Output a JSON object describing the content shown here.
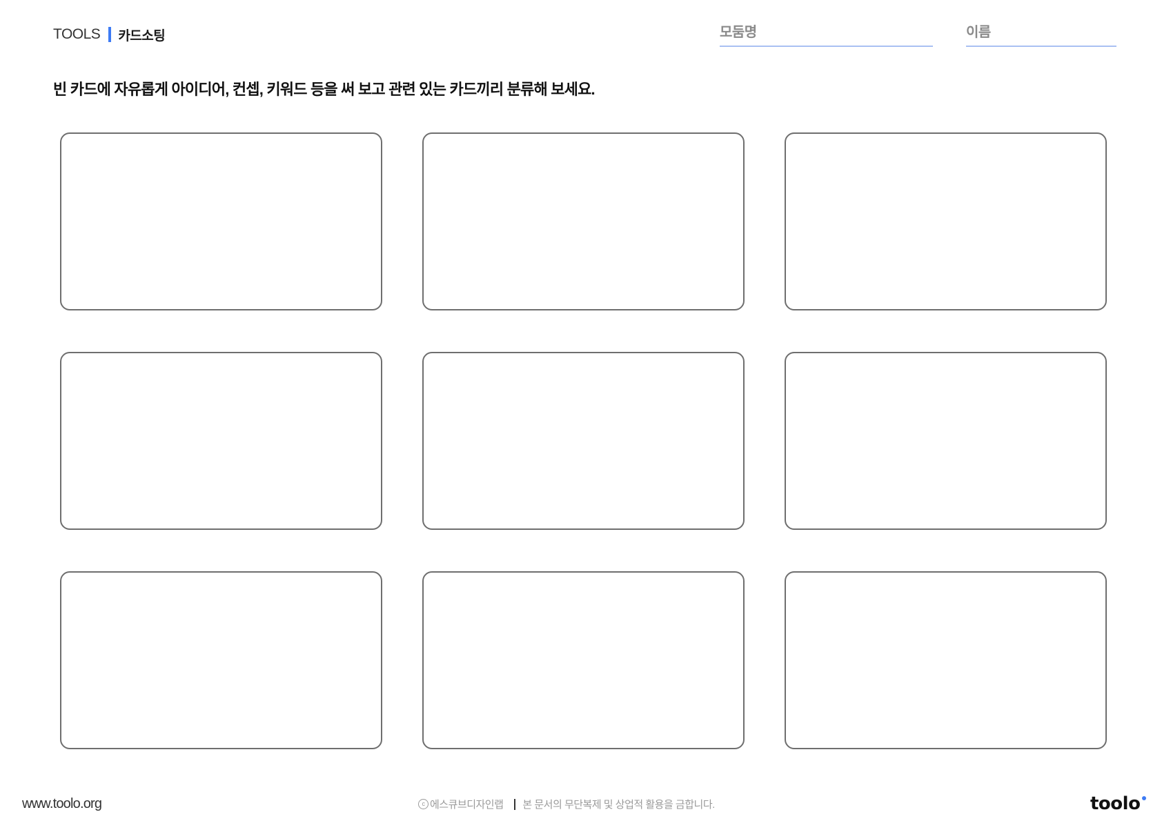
{
  "header": {
    "brand": "TOOLS",
    "tool_name": "카드소팅",
    "accent_color": "#3d7bf4"
  },
  "fields": {
    "group_label": "모둠명",
    "name_label": "이름"
  },
  "instruction": "빈 카드에 자유롭게 아이디어, 컨셉, 키워드 등을 써 보고 관련 있는 카드끼리 분류해 보세요.",
  "cards": {
    "count": 9
  },
  "footer": {
    "url": "www.toolo.org",
    "copyright_symbol": "c",
    "copyright_owner": "에스큐브디자인랩",
    "notice": "본 문서의 무단복제 및 상업적 활용을 금합니다.",
    "logo": "toolo"
  }
}
